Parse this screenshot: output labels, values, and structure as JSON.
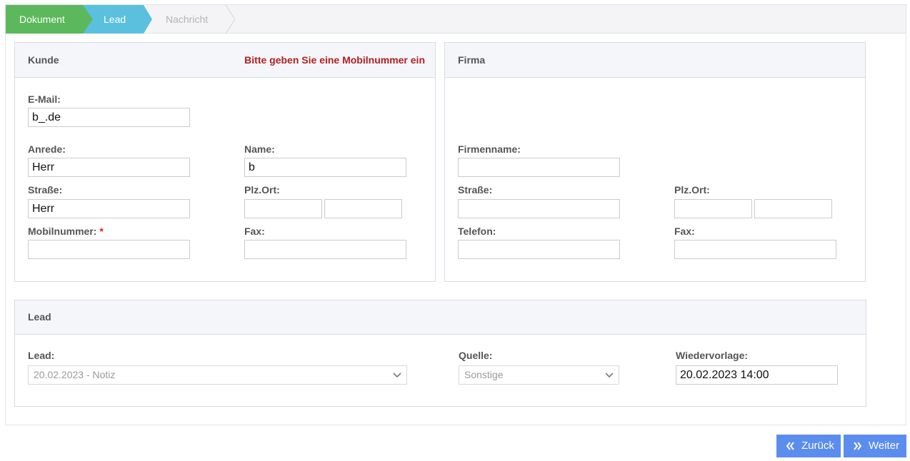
{
  "steps": [
    {
      "label": "Dokument",
      "color": "#5cb85c",
      "state": "done"
    },
    {
      "label": "Lead",
      "color": "#5bc0de",
      "state": "active"
    },
    {
      "label": "Nachricht",
      "color": "#f4f4f6",
      "state": "pending"
    }
  ],
  "kunde": {
    "title": "Kunde",
    "alert": "Bitte geben Sie eine Mobilnummer ein",
    "email_label": "E-Mail:",
    "email_value": "b_.de",
    "anrede_label": "Anrede:",
    "anrede_value": "Herr",
    "name_label": "Name:",
    "name_value": "b",
    "strasse_label": "Straße:",
    "strasse_value": "Herr",
    "plzort_label": "Plz.Ort:",
    "plz_value": "",
    "ort_value": "",
    "mobil_label": "Mobilnummer:",
    "mobil_required": "*",
    "mobil_value": "",
    "fax_label": "Fax:",
    "fax_value": ""
  },
  "firma": {
    "title": "Firma",
    "firmenname_label": "Firmenname:",
    "firmenname_value": "",
    "strasse_label": "Straße:",
    "strasse_value": "",
    "plzort_label": "Plz.Ort:",
    "plz_value": "",
    "ort_value": "",
    "telefon_label": "Telefon:",
    "telefon_value": "",
    "fax_label": "Fax:",
    "fax_value": ""
  },
  "lead": {
    "title": "Lead",
    "lead_label": "Lead:",
    "lead_value": "20.02.2023 - Notiz",
    "quelle_label": "Quelle:",
    "quelle_value": "Sonstige",
    "wiedervorlage_label": "Wiedervorlage:",
    "wiedervorlage_value": "20.02.2023 14:00"
  },
  "buttons": {
    "back_label": "Zurück",
    "next_label": "Weiter",
    "color": "#5b8def"
  }
}
